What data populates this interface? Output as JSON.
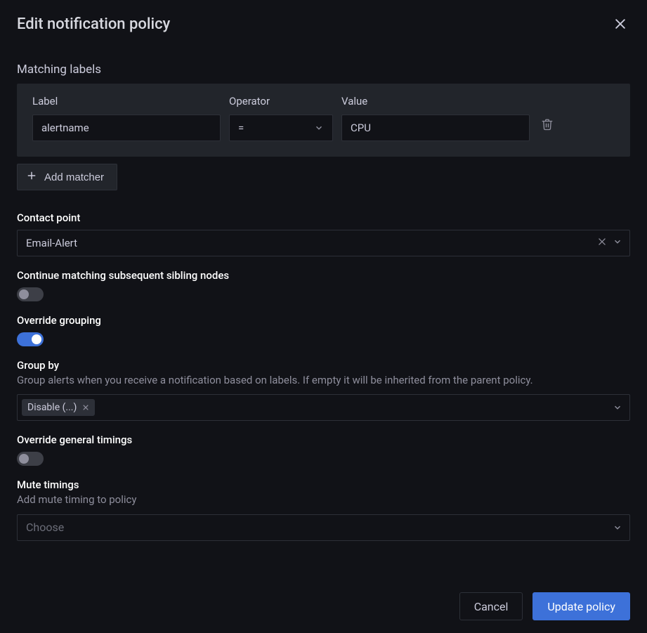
{
  "header": {
    "title": "Edit notification policy"
  },
  "matching": {
    "section_label": "Matching labels",
    "cols": {
      "label": "Label",
      "operator": "Operator",
      "value": "Value"
    },
    "row": {
      "label_value": "alertname",
      "operator_value": "=",
      "value_value": "CPU"
    },
    "add_matcher": "Add matcher"
  },
  "contact_point": {
    "label": "Contact point",
    "value": "Email-Alert"
  },
  "continue_matching": {
    "label": "Continue matching subsequent sibling nodes",
    "on": false
  },
  "override_grouping": {
    "label": "Override grouping",
    "on": true
  },
  "group_by": {
    "label": "Group by",
    "description": "Group alerts when you receive a notification based on labels. If empty it will be inherited from the parent policy.",
    "chip": "Disable (...)"
  },
  "override_timings": {
    "label": "Override general timings",
    "on": false
  },
  "mute": {
    "label": "Mute timings",
    "description": "Add mute timing to policy",
    "placeholder": "Choose"
  },
  "footer": {
    "cancel": "Cancel",
    "submit": "Update policy"
  }
}
